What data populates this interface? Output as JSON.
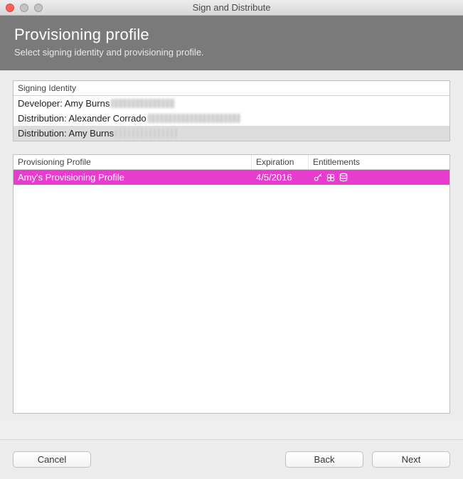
{
  "window": {
    "title": "Sign and Distribute"
  },
  "header": {
    "title": "Provisioning profile",
    "subtitle": "Select signing identity and provisioning profile."
  },
  "identities": {
    "header": "Signing Identity",
    "items": [
      {
        "label": "Developer: Amy Burns",
        "selected": false
      },
      {
        "label": "Distribution: Alexander Corrado",
        "selected": false
      },
      {
        "label": "Distribution: Amy Burns",
        "selected": true
      }
    ]
  },
  "profiles": {
    "columns": {
      "name": "Provisioning Profile",
      "expiration": "Expiration",
      "entitlements": "Entitlements"
    },
    "items": [
      {
        "name": "Amy's Provisioning Profile",
        "expiration": "4/5/2016",
        "selected": true
      }
    ]
  },
  "buttons": {
    "cancel": "Cancel",
    "back": "Back",
    "next": "Next"
  },
  "colors": {
    "selection": "#e83cce",
    "banner": "#7a7a7a"
  }
}
